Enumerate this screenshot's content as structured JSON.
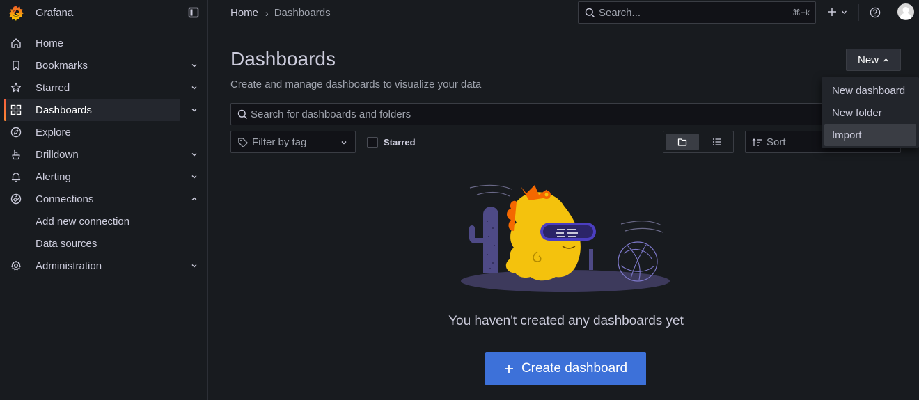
{
  "app": {
    "name": "Grafana",
    "brand_color": "#f46800",
    "accent_color": "#3d71d9"
  },
  "sidebar": {
    "items": [
      {
        "label": "Home",
        "icon": "home-icon"
      },
      {
        "label": "Bookmarks",
        "icon": "bookmark-icon",
        "expandable": true
      },
      {
        "label": "Starred",
        "icon": "star-icon",
        "expandable": true
      },
      {
        "label": "Dashboards",
        "icon": "apps-icon",
        "expandable": true,
        "active": true
      },
      {
        "label": "Explore",
        "icon": "compass-icon"
      },
      {
        "label": "Drilldown",
        "icon": "drilldown-icon",
        "expandable": true
      },
      {
        "label": "Alerting",
        "icon": "bell-icon",
        "expandable": true
      },
      {
        "label": "Connections",
        "icon": "connections-icon",
        "expandable": true,
        "expanded": true
      },
      {
        "label": "Add new connection",
        "sub": true
      },
      {
        "label": "Data sources",
        "sub": true
      },
      {
        "label": "Administration",
        "icon": "cog-icon",
        "expandable": true
      }
    ]
  },
  "topbar": {
    "breadcrumb": {
      "home": "Home",
      "separator": "›",
      "current": "Dashboards"
    },
    "search": {
      "placeholder": "Search...",
      "shortcut": "⌘+k"
    }
  },
  "main": {
    "title": "Dashboards",
    "subtitle": "Create and manage dashboards to visualize your data",
    "new_button": "New",
    "search_placeholder": "Search for dashboards and folders",
    "tag_filter_placeholder": "Filter by tag",
    "starred_label": "Starred",
    "starred_checked": false,
    "view_mode": "folders",
    "sort_placeholder": "Sort",
    "empty_message": "You haven't created any dashboards yet",
    "create_button": "Create dashboard"
  },
  "new_menu": {
    "items": [
      {
        "label": "New dashboard"
      },
      {
        "label": "New folder"
      },
      {
        "label": "Import",
        "highlighted": true
      }
    ]
  }
}
